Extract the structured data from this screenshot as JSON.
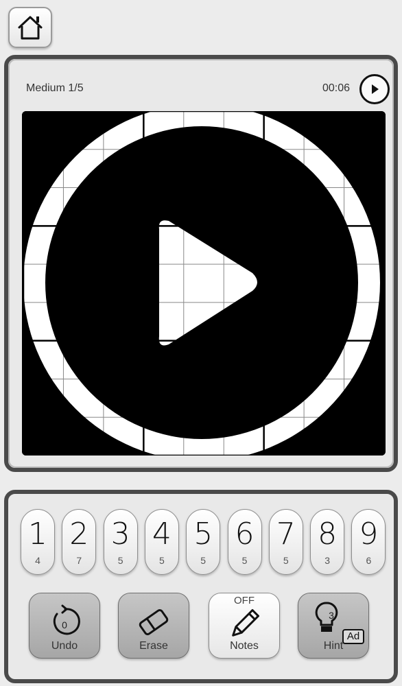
{
  "header": {
    "home_icon": "home-icon"
  },
  "status": {
    "difficulty": "Medium 1/5",
    "timer": "00:06",
    "play_icon": "play-icon"
  },
  "board": {
    "overlay_icon": "play-icon",
    "rows": 9,
    "cols": 9
  },
  "number_pad": [
    {
      "digit": "1",
      "remaining": "4"
    },
    {
      "digit": "2",
      "remaining": "7"
    },
    {
      "digit": "3",
      "remaining": "5"
    },
    {
      "digit": "4",
      "remaining": "5"
    },
    {
      "digit": "5",
      "remaining": "5"
    },
    {
      "digit": "6",
      "remaining": "5"
    },
    {
      "digit": "7",
      "remaining": "5"
    },
    {
      "digit": "8",
      "remaining": "3"
    },
    {
      "digit": "9",
      "remaining": "6"
    }
  ],
  "tools": {
    "undo": {
      "label": "Undo",
      "count": "0",
      "icon": "undo-icon"
    },
    "erase": {
      "label": "Erase",
      "icon": "eraser-icon"
    },
    "notes": {
      "label": "Notes",
      "state": "OFF",
      "icon": "pencil-icon"
    },
    "hint": {
      "label": "Hint",
      "count": "3",
      "badge": "Ad",
      "icon": "lightbulb-icon"
    }
  }
}
